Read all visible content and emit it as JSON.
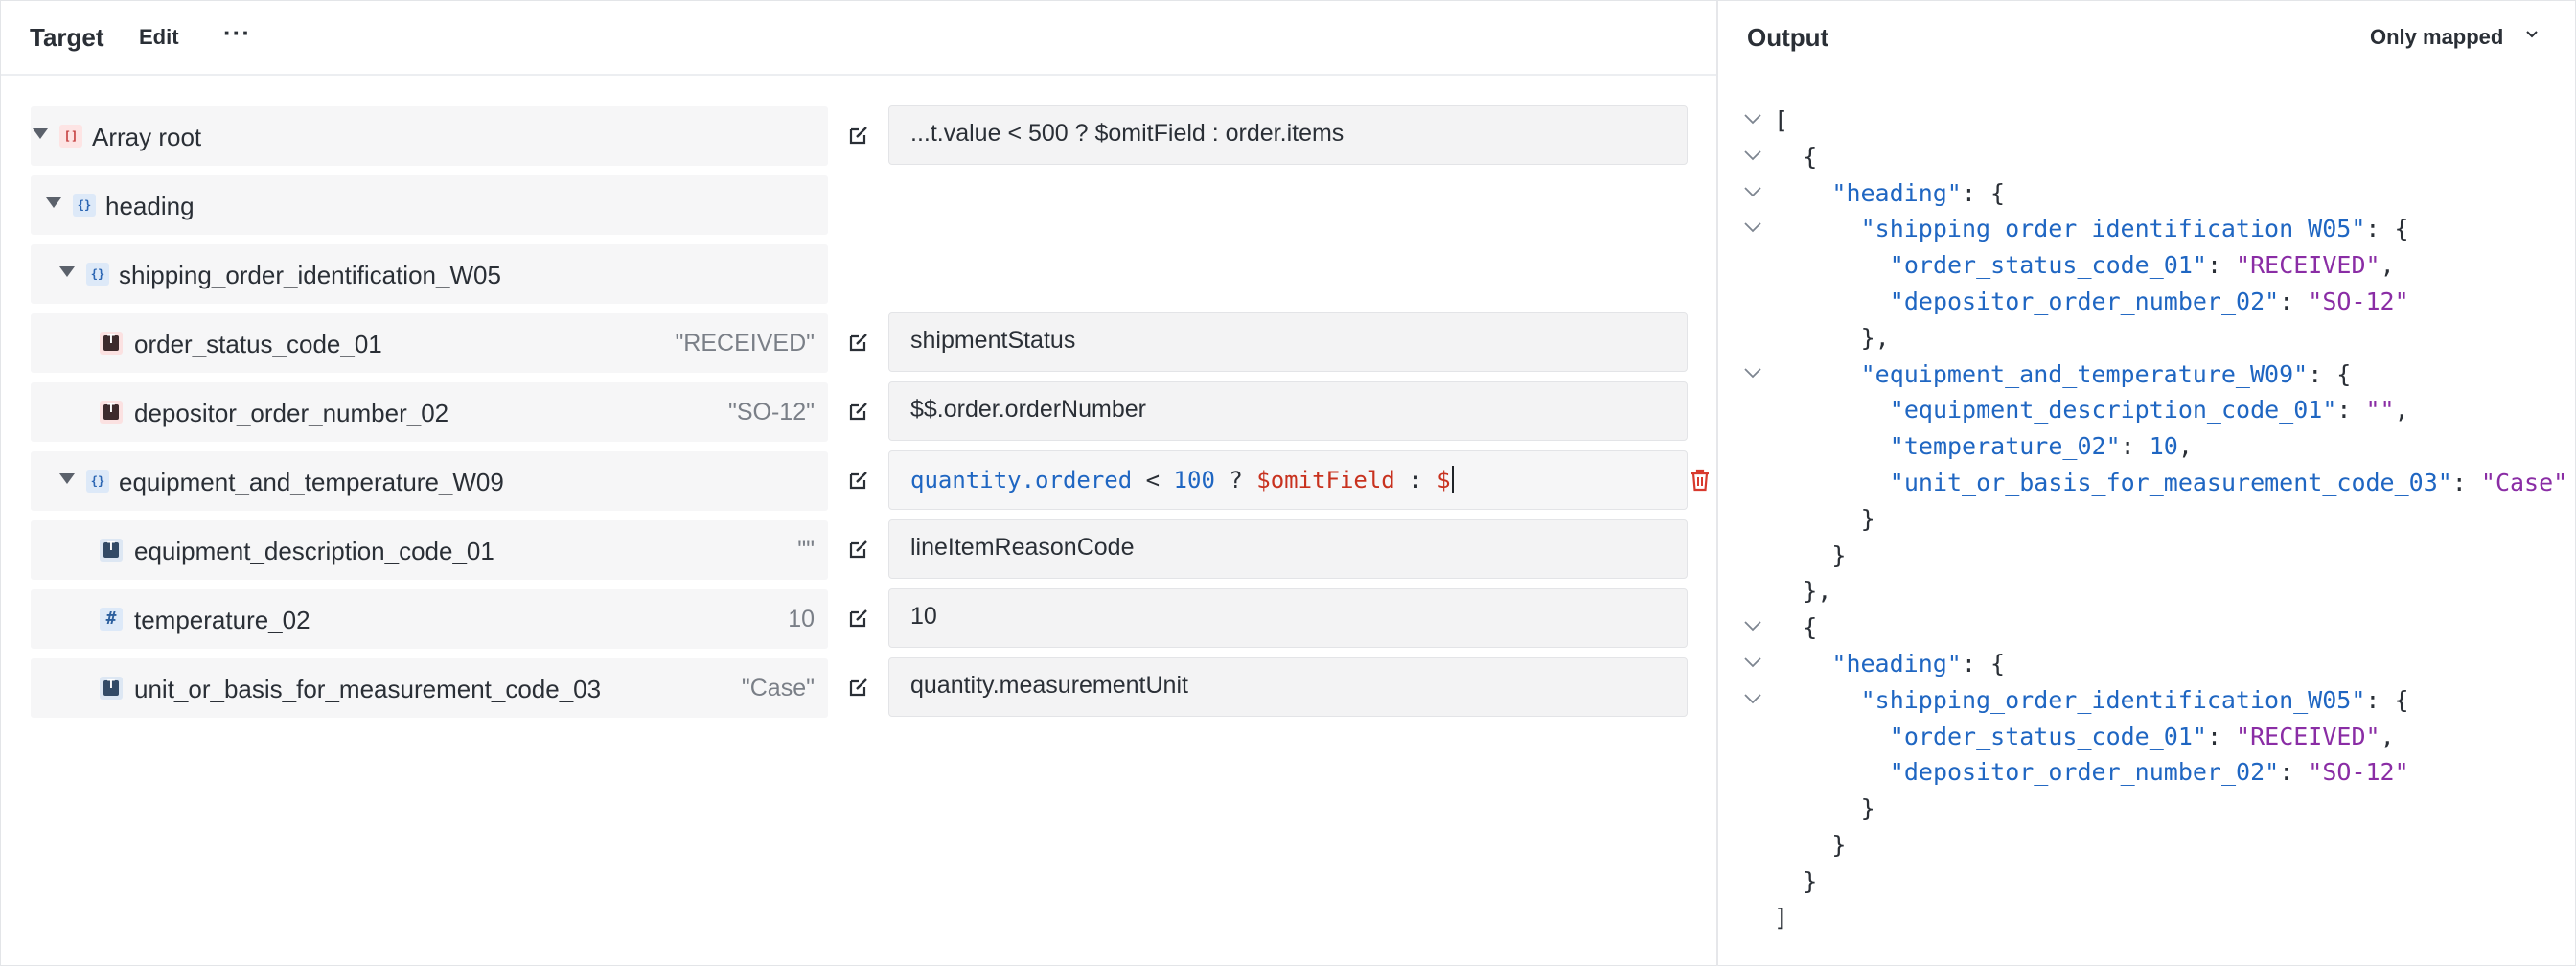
{
  "target_header": {
    "title": "Target",
    "edit": "Edit",
    "more": "···"
  },
  "output_header": {
    "title": "Output",
    "filter": "Only mapped"
  },
  "rows": [
    {
      "label": "Array root",
      "type": "array",
      "expr": "...t.value < 500 ? $omitField : order.items"
    },
    {
      "label": "heading",
      "type": "object"
    },
    {
      "label": "shipping_order_identification_W05",
      "type": "object"
    },
    {
      "label": "order_status_code_01",
      "type": "text",
      "value": "\"RECEIVED\"",
      "expr": "shipmentStatus"
    },
    {
      "label": "depositor_order_number_02",
      "type": "text",
      "value": "\"SO-12\"",
      "expr": "$$.order.orderNumber"
    },
    {
      "label": "equipment_and_temperature_W09",
      "type": "object",
      "expr_tokens": [
        "quantity.ordered",
        "<",
        "100",
        "?",
        "$omitField",
        ":",
        "$"
      ]
    },
    {
      "label": "equipment_description_code_01",
      "type": "text",
      "value": "\"\"",
      "expr": "lineItemReasonCode"
    },
    {
      "label": "temperature_02",
      "type": "number",
      "value": "10",
      "expr": "10"
    },
    {
      "label": "unit_or_basis_for_measurement_code_03",
      "type": "text",
      "value": "\"Case\"",
      "expr": "quantity.measurementUnit"
    }
  ],
  "json_lines": [
    {
      "t": "["
    },
    {
      "t": "{"
    },
    {
      "k": "\"heading\"",
      "t": ": {"
    },
    {
      "k": "\"shipping_order_identification_W05\"",
      "t": ": {"
    },
    {
      "k": "\"order_status_code_01\"",
      "t": ": ",
      "s": "\"RECEIVED\"",
      "e": ","
    },
    {
      "k": "\"depositor_order_number_02\"",
      "t": ": ",
      "s": "\"SO-12\""
    },
    {
      "t": "},"
    },
    {
      "k": "\"equipment_and_temperature_W09\"",
      "t": ": {"
    },
    {
      "k": "\"equipment_description_code_01\"",
      "t": ": ",
      "s": "\"\"",
      "e": ","
    },
    {
      "k": "\"temperature_02\"",
      "t": ": ",
      "n": "10",
      "e": ","
    },
    {
      "k": "\"unit_or_basis_for_measurement_code_03\"",
      "t": ": ",
      "s": "\"Case\""
    },
    {
      "t": "}"
    },
    {
      "t": "}"
    },
    {
      "t": "},"
    },
    {
      "t": "{"
    },
    {
      "k": "\"heading\"",
      "t": ": {"
    },
    {
      "k": "\"shipping_order_identification_W05\"",
      "t": ": {"
    },
    {
      "k": "\"order_status_code_01\"",
      "t": ": ",
      "s": "\"RECEIVED\"",
      "e": ","
    },
    {
      "k": "\"depositor_order_number_02\"",
      "t": ": ",
      "s": "\"SO-12\""
    },
    {
      "t": "}"
    },
    {
      "t": "}"
    },
    {
      "t": "}"
    },
    {
      "t": "]"
    }
  ],
  "colors": {
    "key": "#1f66c2",
    "string": "#8a2da5",
    "expr_red": "#c8321f",
    "row_bg": "#f6f6f7"
  }
}
